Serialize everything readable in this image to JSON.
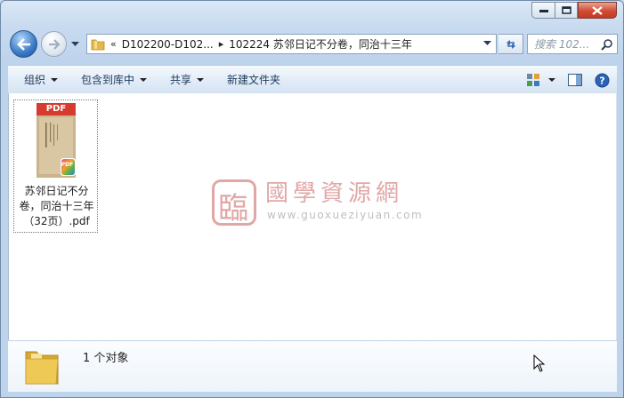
{
  "window": {
    "colors": {
      "accent": "#3a79c4",
      "close": "#c53a22",
      "pdf_red": "#d63b2f",
      "watermark": "#c96060"
    }
  },
  "address_bar": {
    "overflow_chevron": "«",
    "crumbs": [
      "D102200-D102...",
      "102224 苏邻日记不分卷，同治十三年"
    ],
    "separator": "▸"
  },
  "search": {
    "placeholder": "搜索 102..."
  },
  "toolbar": {
    "organize": "组织",
    "include_in_library": "包含到库中",
    "share": "共享",
    "new_folder": "新建文件夹"
  },
  "file": {
    "badge": "PDF",
    "name_line1": "苏邻日记不分",
    "name_line2": "卷，同治十三年",
    "name_line3": "（32页）.pdf"
  },
  "watermark": {
    "seal": "臨",
    "title": "國學資源網",
    "url": "www.guoxueziyuan.com"
  },
  "details": {
    "count_text": "1 个对象"
  }
}
